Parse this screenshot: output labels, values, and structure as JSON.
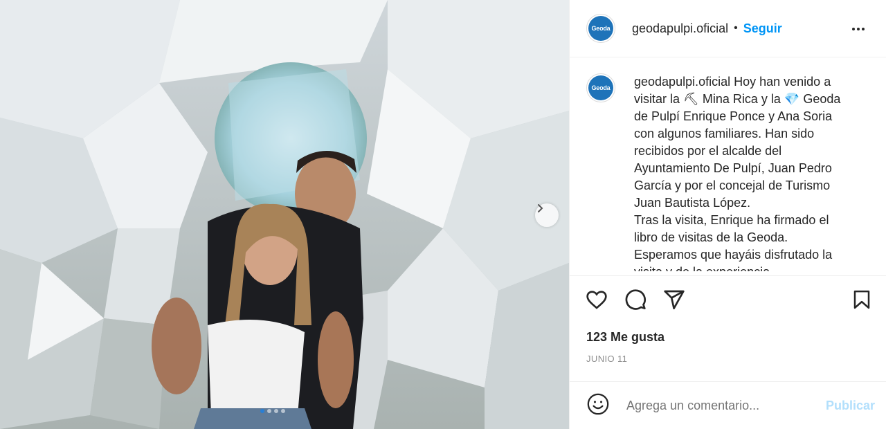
{
  "post": {
    "username": "geodapulpi.oficial",
    "separator": "•",
    "follow_label": "Seguir",
    "avatar_text": "Geoda",
    "caption_text": " Hoy han venido a visitar la ⛏ Mina Rica y la 💎 Geoda de Pulpí Enrique Ponce y Ana Soria con algunos familiares. Han sido recibidos por el alcalde del Ayuntamiento De Pulpí, Juan Pedro García y por el concejal de Turismo Juan Bautista López.\nTras la visita, Enrique ha firmado el libro de visitas de la Geoda.\nEsperamos que hayáis disfrutado la visita y de la experiencia",
    "likes": "123 Me gusta",
    "date": "JUNIO 11",
    "carousel": {
      "total": 4,
      "active": 1
    }
  },
  "icons": {
    "like": "heart-icon",
    "comment": "comment-icon",
    "share": "send-icon",
    "save": "bookmark-icon",
    "more": "more-options-icon",
    "emoji": "emoji-icon",
    "next": "chevron-right-icon"
  },
  "comment": {
    "placeholder": "Agrega un comentario...",
    "publish_label": "Publicar"
  },
  "colors": {
    "accent": "#0095f6",
    "publish_disabled": "#b2dffc",
    "muted": "#8e8e8e"
  }
}
